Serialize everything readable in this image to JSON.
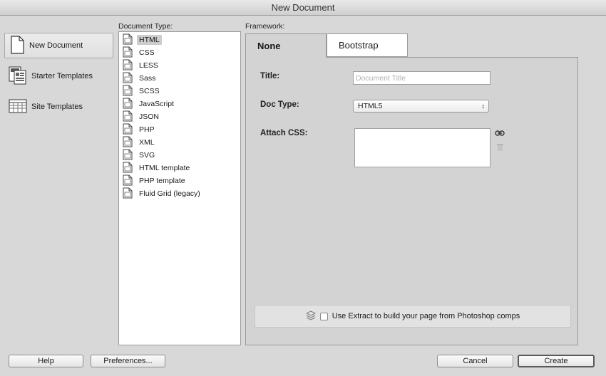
{
  "window": {
    "title": "New Document"
  },
  "categories": [
    {
      "label": "New Document",
      "icon": "blank-page-icon",
      "selected": true
    },
    {
      "label": "Starter Templates",
      "icon": "starter-templates-icon",
      "selected": false
    },
    {
      "label": "Site Templates",
      "icon": "site-templates-icon",
      "selected": false
    }
  ],
  "document_type": {
    "label": "Document Type:",
    "items": [
      "HTML",
      "CSS",
      "LESS",
      "Sass",
      "SCSS",
      "JavaScript",
      "JSON",
      "PHP",
      "XML",
      "SVG",
      "HTML template",
      "PHP template",
      "Fluid Grid (legacy)"
    ],
    "selected": "HTML"
  },
  "framework": {
    "label": "Framework:",
    "tabs": [
      "None",
      "Bootstrap"
    ],
    "active_tab": "None"
  },
  "form": {
    "title_label": "Title:",
    "title_placeholder": "Document Title",
    "title_value": "",
    "doctype_label": "Doc Type:",
    "doctype_value": "HTML5",
    "attach_css_label": "Attach CSS:"
  },
  "extract": {
    "label": "Use Extract to build your page from Photoshop comps",
    "checked": false
  },
  "buttons": {
    "help": "Help",
    "preferences": "Preferences...",
    "cancel": "Cancel",
    "create": "Create"
  }
}
